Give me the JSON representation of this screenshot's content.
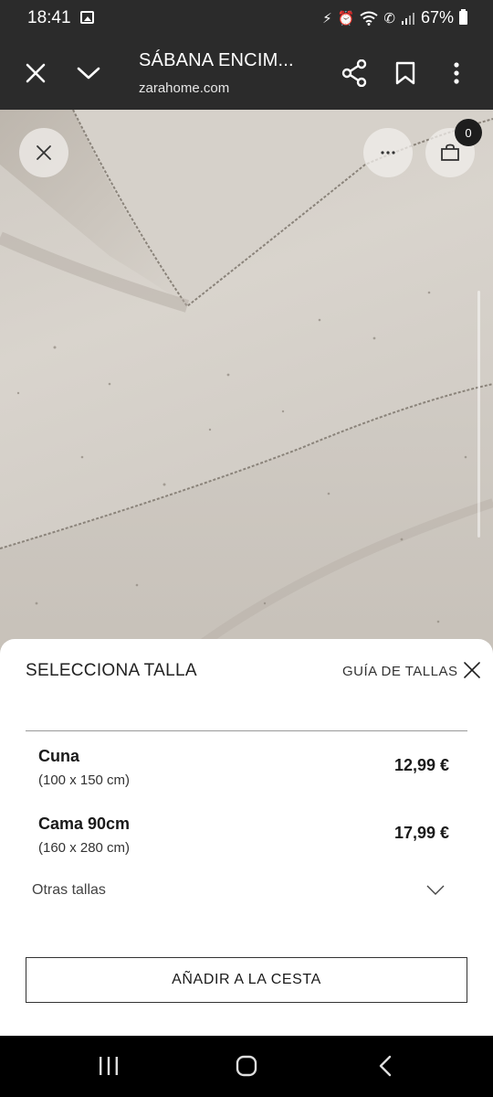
{
  "status_bar": {
    "time": "18:41",
    "battery": "67%",
    "icons": [
      "image-icon",
      "battery-saver-icon",
      "alarm-icon",
      "wifi-icon",
      "wifi-call-icon",
      "signal-icon",
      "battery-icon"
    ]
  },
  "browser": {
    "title": "SÁBANA ENCIM...",
    "domain": "zarahome.com",
    "icons": [
      "close-icon",
      "chevron-down-icon",
      "share-icon",
      "bookmark-icon",
      "more-vertical-icon"
    ]
  },
  "product": {
    "bag_count": "0",
    "icons": [
      "close-icon",
      "more-horizontal-icon",
      "shopping-bag-icon"
    ]
  },
  "size_sheet": {
    "title": "SELECCIONA TALLA",
    "size_guide": "GUÍA DE TALLAS",
    "sizes": [
      {
        "name": "Cuna",
        "dims": "(100 x 150 cm)",
        "price": "12,99 €"
      },
      {
        "name": "Cama 90cm",
        "dims": "(160 x 280 cm)",
        "price": "17,99 €"
      }
    ],
    "other_sizes": "Otras tallas",
    "add_to_cart": "AÑADIR A LA CESTA"
  },
  "nav": {
    "icons": [
      "recents-icon",
      "home-icon",
      "back-icon"
    ]
  },
  "colors": {
    "toolbar": "#2b2b2b",
    "sheet_bg": "#ffffff",
    "text_dark": "#1a1a1a"
  }
}
